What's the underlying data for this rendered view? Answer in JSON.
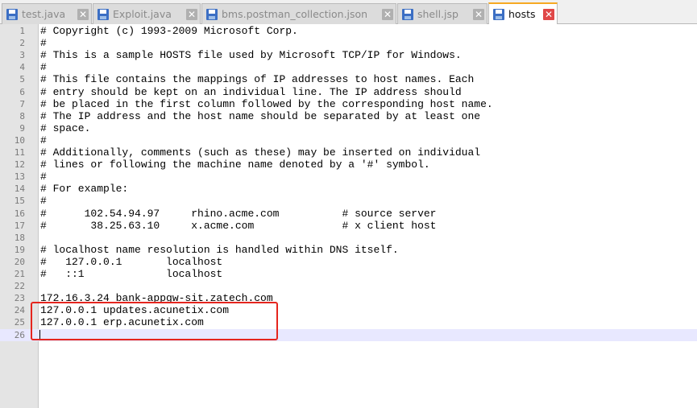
{
  "tabs": [
    {
      "label": "test.java",
      "active": false
    },
    {
      "label": "Exploit.java",
      "active": false
    },
    {
      "label": "bms.postman_collection.json",
      "active": false
    },
    {
      "label": "shell.jsp",
      "active": false
    },
    {
      "label": "hosts",
      "active": true
    }
  ],
  "icons": {
    "tab_save": "floppy-disk-icon",
    "tab_close": "close-icon",
    "close_glyph": "✕"
  },
  "colors": {
    "active_tab_accent": "#f6a923",
    "highlight_box": "#e5251e",
    "current_line": "#e8e8ff"
  },
  "editor": {
    "current_line": 26,
    "lines": [
      {
        "n": "1",
        "text": "# Copyright (c) 1993-2009 Microsoft Corp."
      },
      {
        "n": "2",
        "text": "#"
      },
      {
        "n": "3",
        "text": "# This is a sample HOSTS file used by Microsoft TCP/IP for Windows."
      },
      {
        "n": "4",
        "text": "#"
      },
      {
        "n": "5",
        "text": "# This file contains the mappings of IP addresses to host names. Each"
      },
      {
        "n": "6",
        "text": "# entry should be kept on an individual line. The IP address should"
      },
      {
        "n": "7",
        "text": "# be placed in the first column followed by the corresponding host name."
      },
      {
        "n": "8",
        "text": "# The IP address and the host name should be separated by at least one"
      },
      {
        "n": "9",
        "text": "# space."
      },
      {
        "n": "10",
        "text": "#"
      },
      {
        "n": "11",
        "text": "# Additionally, comments (such as these) may be inserted on individual"
      },
      {
        "n": "12",
        "text": "# lines or following the machine name denoted by a '#' symbol."
      },
      {
        "n": "13",
        "text": "#"
      },
      {
        "n": "14",
        "text": "# For example:"
      },
      {
        "n": "15",
        "text": "#"
      },
      {
        "n": "16",
        "text": "#      102.54.94.97     rhino.acme.com          # source server"
      },
      {
        "n": "17",
        "text": "#       38.25.63.10     x.acme.com              # x client host"
      },
      {
        "n": "18",
        "text": ""
      },
      {
        "n": "19",
        "text": "# localhost name resolution is handled within DNS itself."
      },
      {
        "n": "20",
        "text": "#   127.0.0.1       localhost"
      },
      {
        "n": "21",
        "text": "#   ::1             localhost"
      },
      {
        "n": "22",
        "text": ""
      },
      {
        "n": "23",
        "text": "172.16.3.24 bank-appgw-sit.zatech.com"
      },
      {
        "n": "24",
        "text": "127.0.0.1 updates.acunetix.com"
      },
      {
        "n": "25",
        "text": "127.0.0.1 erp.acunetix.com"
      },
      {
        "n": "26",
        "text": ""
      }
    ]
  }
}
